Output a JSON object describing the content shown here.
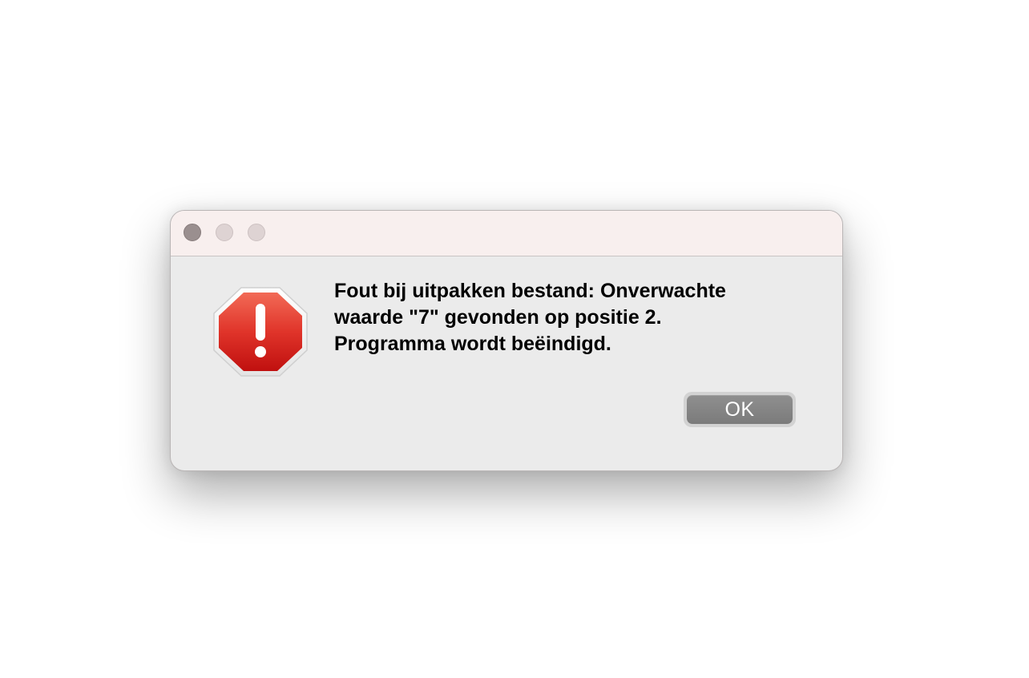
{
  "window": {
    "controls": [
      {
        "name": "close",
        "color": "#9a8f8f"
      },
      {
        "name": "minimize",
        "color": "#ded3d3"
      },
      {
        "name": "zoom",
        "color": "#ded3d3"
      }
    ]
  },
  "alert": {
    "icon": "stop-sign-exclamation-icon",
    "icon_color": "#d81f1a",
    "message": "Fout bij uitpakken bestand: Onverwachte\nwaarde \"7\" gevonden op positie 2.\nProgramma wordt beëindigd."
  },
  "buttons": {
    "ok_label": "OK"
  },
  "colors": {
    "dialog_background": "#ebebeb",
    "titlebar_background": "#f8efee",
    "button_background": "#858585"
  }
}
